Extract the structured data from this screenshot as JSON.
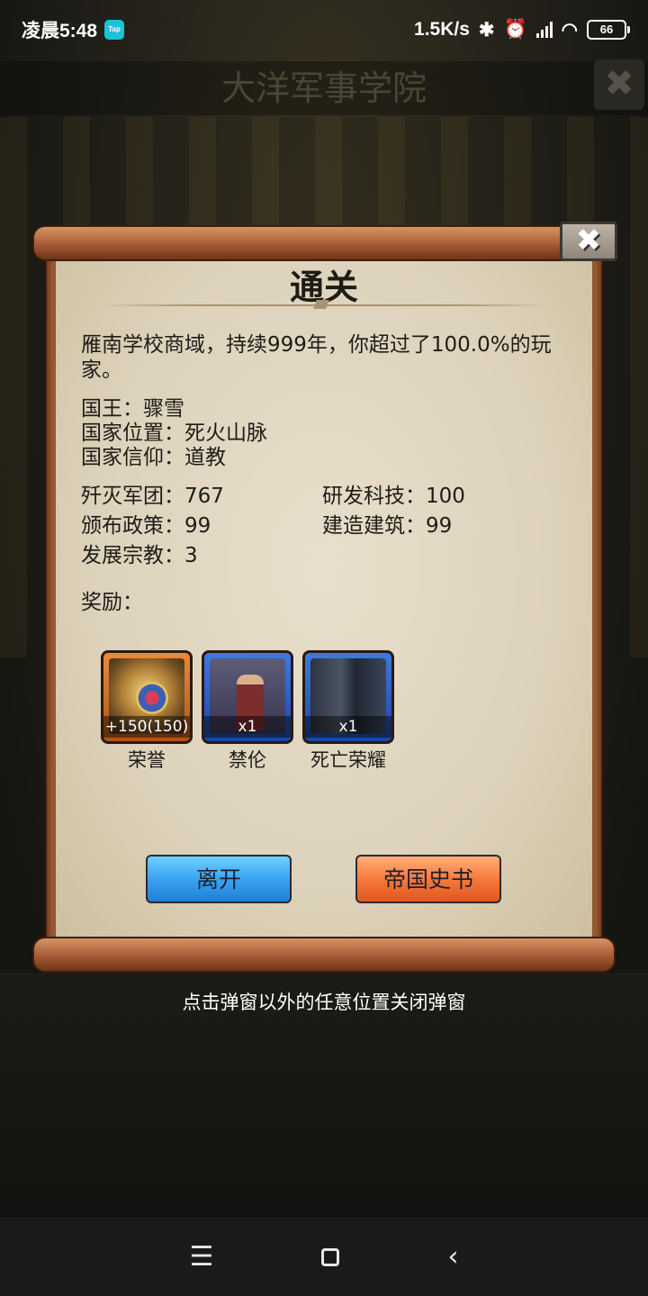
{
  "status_bar": {
    "time": "凌晨5:48",
    "app_badge": "Tap",
    "net_speed": "1.5K/s",
    "battery": "66"
  },
  "background": {
    "title": "大洋军事学院"
  },
  "dialog": {
    "title": "通关",
    "summary": "雁南学校商域，持续999年，你超过了100.0%的玩家。",
    "king": "国王：骤雪",
    "location": "国家位置：死火山脉",
    "religion": "国家信仰：道教",
    "stats": {
      "legions_destroyed": "歼灭军团：767",
      "tech_researched": "研发科技：100",
      "policies_issued": "颁布政策：99",
      "buildings_built": "建造建筑：99",
      "religions_developed": "发展宗教：3"
    },
    "rewards_label": "奖励：",
    "rewards": [
      {
        "name": "荣誉",
        "count": "+150(150)",
        "icon": "medal-icon",
        "frame": "orange"
      },
      {
        "name": "禁伦",
        "count": "x1",
        "icon": "hero-portrait",
        "frame": "blue"
      },
      {
        "name": "死亡荣耀",
        "count": "x1",
        "icon": "hall-art",
        "frame": "blue"
      }
    ],
    "leave_label": "离开",
    "history_label": "帝国史书"
  },
  "hint": "点击弹窗以外的任意位置关闭弹窗",
  "nav": {
    "menu_icon": "menu-icon",
    "home_icon": "home-icon",
    "back_icon": "back-icon"
  },
  "colors": {
    "leave_button": "#3aa4f1",
    "history_button": "#f77a3c",
    "paper": "#ddd2bb",
    "wood": "#a55a34"
  }
}
